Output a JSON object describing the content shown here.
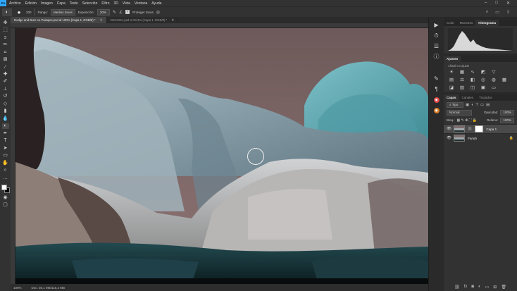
{
  "menubar": {
    "logo": "Ps",
    "items": [
      "Archivo",
      "Edición",
      "Imagen",
      "Capa",
      "Texto",
      "Selección",
      "Filtro",
      "3D",
      "Vista",
      "Ventana",
      "Ayuda"
    ],
    "window_controls": [
      "–",
      "□",
      "✕"
    ]
  },
  "options": {
    "tool_icon": "sponge-tool-icon",
    "brush_size": "200",
    "rango_label": "Rango:",
    "rango_value": "Medios tonos",
    "exposicion_label": "Exposición:",
    "exposicion_value": "20%",
    "proteger_label": "Proteger tonos",
    "proteger_checked": true
  },
  "tabs": [
    {
      "label": "Dodge and Burn en Paisajes.psd al 100% (Capa 1, RGB/8) *",
      "active": true
    },
    {
      "label": "DSC4911.psd al 33,3% (Capa 1, RGB/8) *",
      "active": false
    }
  ],
  "status": {
    "zoom": "100%",
    "doc": "Doc: 35,1 MB/115,2 MB"
  },
  "right": {
    "top_tabs": [
      "Color",
      "Muestras",
      "Histograma"
    ],
    "adjust_tab": "Ajustes",
    "adjust_hint": "Añadir un ajuste",
    "layers_tabs": [
      "Capas",
      "Canales",
      "Trazados"
    ],
    "kind_label": "Tipo",
    "blend_mode": "Normal",
    "opacity_label": "Opacidad:",
    "opacity_value": "100%",
    "block_label": "Bloq.:",
    "fill_label": "Relleno:",
    "fill_value": "100%",
    "layers": [
      {
        "name": "Capa 1",
        "active": true,
        "has_mask": true
      },
      {
        "name": "Fondo",
        "active": false,
        "has_mask": false
      }
    ]
  },
  "colors": {
    "foreground": "#ffffff",
    "background": "#000000",
    "accent": "#31a8ff"
  }
}
